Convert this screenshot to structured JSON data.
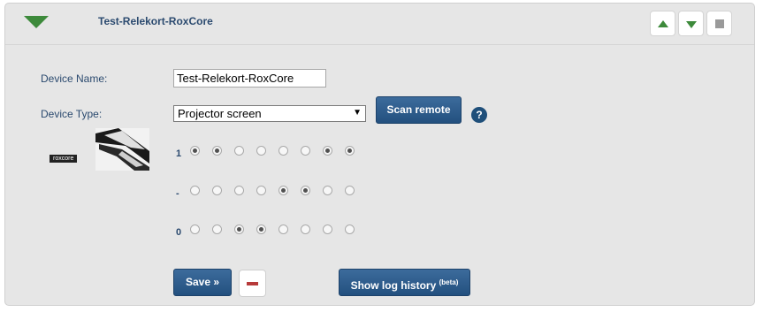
{
  "header": {
    "title": "Test-Relekort-RoxCore"
  },
  "form": {
    "device_name_label": "Device Name:",
    "device_name_value": "Test-Relekort-RoxCore",
    "device_type_label": "Device Type:",
    "device_type_value": "Projector screen",
    "scan_button": "Scan remote",
    "help_icon": "?"
  },
  "logo": {
    "brand_text": "roxcore"
  },
  "relay_rows": [
    {
      "label": "1",
      "states": [
        true,
        true,
        false,
        false,
        false,
        false,
        true,
        true
      ]
    },
    {
      "label": "-",
      "states": [
        false,
        false,
        false,
        false,
        true,
        true,
        false,
        false
      ]
    },
    {
      "label": "0",
      "states": [
        false,
        false,
        true,
        true,
        false,
        false,
        false,
        false
      ]
    }
  ],
  "footer": {
    "save_label": "Save »",
    "log_label": "Show log history",
    "log_badge": "(beta)"
  },
  "colors": {
    "accent_green": "#3d8a3b",
    "button_blue": "#2a5a8c",
    "delete_red": "#b73a3a",
    "label_blue": "#2b4a6f"
  }
}
